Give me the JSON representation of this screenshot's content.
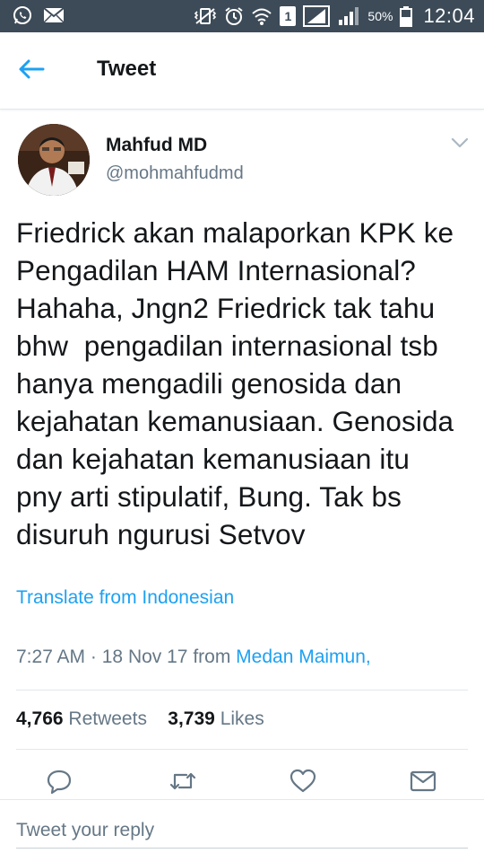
{
  "status_bar": {
    "battery_percent": "50%",
    "time": "12:04",
    "sim_slot": "1",
    "icons": [
      "whatsapp-icon",
      "mail-icon",
      "vibrate-icon",
      "alarm-icon",
      "wifi-icon",
      "sim-icon",
      "signal-icon",
      "signal-2-icon",
      "battery-icon"
    ]
  },
  "header": {
    "title": "Tweet",
    "back_icon": "back-arrow-icon"
  },
  "tweet": {
    "author_name": "Mahfud MD",
    "author_handle": "@mohmahfudmd",
    "text": "Friedrick akan malaporkan KPK ke\nPengadilan HAM Internasional?\nHahaha, Jngn2 Friedrick tak tahu\nbhw  pengadilan internasional tsb\nhanya mengadili genosida dan\nkejahatan kemanusiaan. Genosida\ndan kejahatan kemanusiaan itu\npny arti stipulatif, Bung. Tak bs\ndisuruh ngurusi Setvov",
    "translate_label": "Translate from Indonesian",
    "time": "7:27 AM",
    "separator": "·",
    "date": "18 Nov 17",
    "from_label": "from",
    "place": "Medan Maimun,",
    "retweets_count": "4,766",
    "retweets_label": "Retweets",
    "likes_count": "3,739",
    "likes_label": "Likes"
  },
  "actions": [
    "reply-icon",
    "retweet-icon",
    "like-icon",
    "message-icon"
  ],
  "reply": {
    "placeholder": "Tweet your reply"
  },
  "colors": {
    "status_bar": "#3d4b58",
    "accent": "#1da1f2",
    "secondary_text": "#657786",
    "divider": "#e1e8ed"
  }
}
